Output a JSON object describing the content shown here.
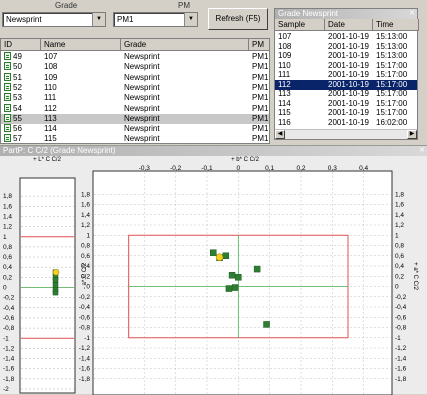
{
  "filter": {
    "grade_label": "Grade",
    "grade_value": "Newsprint",
    "pm_label": "PM",
    "pm_value": "PM1",
    "refresh_label": "Refresh (F5)"
  },
  "sample_table": {
    "columns": [
      "ID",
      "Name",
      "Grade",
      "PM"
    ],
    "rows": [
      {
        "id": "49",
        "name": "107",
        "grade": "Newsprint",
        "pm": "PM1"
      },
      {
        "id": "50",
        "name": "108",
        "grade": "Newsprint",
        "pm": "PM1"
      },
      {
        "id": "51",
        "name": "109",
        "grade": "Newsprint",
        "pm": "PM1"
      },
      {
        "id": "52",
        "name": "110",
        "grade": "Newsprint",
        "pm": "PM1"
      },
      {
        "id": "53",
        "name": "111",
        "grade": "Newsprint",
        "pm": "PM1"
      },
      {
        "id": "54",
        "name": "112",
        "grade": "Newsprint",
        "pm": "PM1"
      },
      {
        "id": "55",
        "name": "113",
        "grade": "Newsprint",
        "pm": "PM1"
      },
      {
        "id": "56",
        "name": "114",
        "grade": "Newsprint",
        "pm": "PM1"
      },
      {
        "id": "57",
        "name": "115",
        "grade": "Newsprint",
        "pm": "PM1"
      }
    ],
    "selected_index": 6
  },
  "grade_panel": {
    "title": "Grade Newsprint",
    "close_icon": "close-icon",
    "columns": [
      "Sample",
      "Date",
      "Time"
    ],
    "rows": [
      {
        "sample": "107",
        "date": "2001-10-19",
        "time": "15:13:00"
      },
      {
        "sample": "108",
        "date": "2001-10-19",
        "time": "15:13:00"
      },
      {
        "sample": "109",
        "date": "2001-10-19",
        "time": "15:13:00"
      },
      {
        "sample": "110",
        "date": "2001-10-19",
        "time": "15:17:00"
      },
      {
        "sample": "111",
        "date": "2001-10-19",
        "time": "15:17:00"
      },
      {
        "sample": "112",
        "date": "2001-10-19",
        "time": "15:17:00"
      },
      {
        "sample": "113",
        "date": "2001-10-19",
        "time": "15:17:00"
      },
      {
        "sample": "114",
        "date": "2001-10-19",
        "time": "15:17:00"
      },
      {
        "sample": "115",
        "date": "2001-10-19",
        "time": "15:17:00"
      },
      {
        "sample": "116",
        "date": "2001-10-19",
        "time": "16:02:00"
      }
    ],
    "selected_index": 5
  },
  "chart_window": {
    "title": "PartP: C C/2 (Grade Newsprint)"
  },
  "chart_data": [
    {
      "type": "scatter",
      "title": "+ L* C C/2",
      "ylim": [
        -2,
        2
      ],
      "yticks": [
        "1,8",
        "1,6",
        "1,4",
        "1,2",
        "1",
        "0,8",
        "0,6",
        "0,4",
        "0,2",
        "0",
        "-0,2",
        "-0,4",
        "-0,6",
        "-0,8",
        "-1",
        "-1,2",
        "-1,4",
        "-1,6",
        "-1,8",
        "-2"
      ],
      "limits": [
        1,
        -1
      ],
      "points": [
        0.3,
        0.2,
        0.15,
        0.05,
        -0.05,
        -0.1
      ],
      "highlight": 0.3,
      "colors": {
        "point": "#2e7d32",
        "highlight": "#f5d020",
        "limit": "#e05050",
        "center": "#4caf50"
      }
    },
    {
      "type": "scatter",
      "title": "+ b* C C/2",
      "xlabel": "+ b* C C/2",
      "ylabel": "- a* C C/2",
      "ylabel_right": "+ a* C C/2",
      "xlim": [
        -0.5,
        0.5
      ],
      "ylim": [
        -2,
        2
      ],
      "xticks": [
        "-0,3",
        "-0,2",
        "-0,1",
        "0",
        "0,1",
        "0,2",
        "0,3",
        "0,4"
      ],
      "xtick_values": [
        -0.3,
        -0.2,
        -0.1,
        0,
        0.1,
        0.2,
        0.3,
        0.4
      ],
      "yticks": [
        "1,8",
        "1,6",
        "1,4",
        "1,2",
        "1",
        "0,8",
        "0,6",
        "0,4",
        "0,2",
        "0",
        "-0,2",
        "-0,4",
        "-0,6",
        "-0,8",
        "-1",
        "-1,2",
        "-1,4",
        "-1,6",
        "-1,8"
      ],
      "ytick_values": [
        1.8,
        1.6,
        1.4,
        1.2,
        1,
        0.8,
        0.6,
        0.4,
        0.2,
        0,
        -0.2,
        -0.4,
        -0.6,
        -0.8,
        -1,
        -1.2,
        -1.4,
        -1.6,
        -1.8
      ],
      "limit_box": {
        "x": [
          -0.35,
          0.35
        ],
        "y": [
          -1,
          1
        ]
      },
      "points": [
        {
          "x": -0.08,
          "y": 0.66
        },
        {
          "x": -0.04,
          "y": 0.6
        },
        {
          "x": -0.06,
          "y": 0.56
        },
        {
          "x": -0.02,
          "y": 0.22
        },
        {
          "x": 0.0,
          "y": 0.18
        },
        {
          "x": -0.03,
          "y": -0.04
        },
        {
          "x": -0.01,
          "y": -0.02
        },
        {
          "x": 0.06,
          "y": 0.34
        },
        {
          "x": 0.09,
          "y": -0.74
        }
      ],
      "highlight": {
        "x": -0.06,
        "y": 0.57
      },
      "colors": {
        "point": "#2e7d32",
        "highlight": "#f5d020",
        "limit": "#e05050",
        "center": "#4caf50"
      }
    }
  ]
}
